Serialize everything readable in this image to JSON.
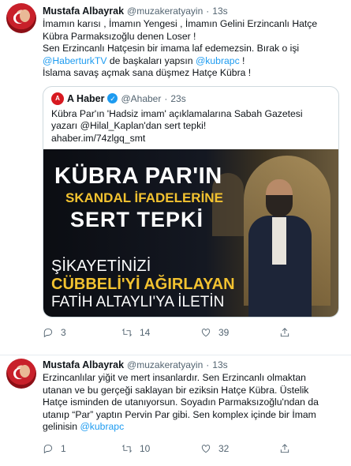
{
  "tweets": [
    {
      "name": "Mustafa Albayrak",
      "handle": "@muzakeratyayin",
      "dot": "·",
      "time": "13s",
      "lines": [
        {
          "parts": [
            {
              "t": "İmamın karısı , İmamın Yengesi , İmamın Gelini Erzincanlı Hatçe",
              "link": false
            }
          ]
        },
        {
          "parts": [
            {
              "t": "Kübra Parmaksızoğlu denen Loser !",
              "link": false
            }
          ]
        },
        {
          "parts": [
            {
              "t": "Sen Erzincanlı Hatçesin bir imama laf edemezsin. Bırak o işi",
              "link": false
            }
          ]
        },
        {
          "parts": [
            {
              "t": "@HaberturkTV",
              "link": true
            },
            {
              "t": " de başkaları yapsın ",
              "link": false
            },
            {
              "t": "@kubrapc",
              "link": true
            },
            {
              "t": " !",
              "link": false
            }
          ]
        },
        {
          "parts": [
            {
              "t": "İslama savaş açmak sana düşmez Hatçe Kübra !",
              "link": false
            }
          ]
        }
      ],
      "quote": {
        "logo_text": "A",
        "name": "A Haber",
        "verified_icon": "✓",
        "handle": "@Ahaber",
        "dot": "·",
        "time": "23s",
        "lines": [
          {
            "parts": [
              {
                "t": "Kübra Par'ın 'Hadsiz imam' açıklamalarına Sabah Gazetesi",
                "link": false
              }
            ]
          },
          {
            "parts": [
              {
                "t": "yazarı @Hilal_Kaplan'dan sert tepki!",
                "link": false
              }
            ]
          },
          {
            "parts": [
              {
                "t": "ahaber.im/74zlgq_smt",
                "link": false
              }
            ]
          }
        ],
        "image_text": {
          "line1": "KÜBRA PAR'IN",
          "line2": "SKANDAL İFADELERİNE",
          "line3": "SERT TEPKİ",
          "line4": "ŞİKAYETİNİZİ",
          "line5": "CÜBBELİ'Yİ AĞIRLAYAN",
          "line6": "FATİH ALTAYLI'YA İLETİN"
        }
      },
      "actions": {
        "reply": "3",
        "retweet": "14",
        "like": "39",
        "share": ""
      }
    },
    {
      "name": "Mustafa Albayrak",
      "handle": "@muzakeratyayin",
      "dot": "·",
      "time": "13s",
      "lines": [
        {
          "parts": [
            {
              "t": "Erzincanlılar yiğit ve mert insanlardır. Sen Erzincanlı olmaktan",
              "link": false
            }
          ]
        },
        {
          "parts": [
            {
              "t": "utanan ve bu gerçeği saklayan bir eziksin Hatçe Kübra. Üstelik",
              "link": false
            }
          ]
        },
        {
          "parts": [
            {
              "t": "Hatçe isminden de utanıyorsun. Soyadın Parmaksızoğlu'ndan da",
              "link": false
            }
          ]
        },
        {
          "parts": [
            {
              "t": "utanıp “Par” yaptın Pervin Par gibi. Sen  komplex içinde bir İmam",
              "link": false
            }
          ]
        },
        {
          "parts": [
            {
              "t": "gelinisin ",
              "link": false
            },
            {
              "t": "@kubrapc",
              "link": true
            }
          ]
        }
      ],
      "actions": {
        "reply": "1",
        "retweet": "10",
        "like": "32",
        "share": ""
      }
    }
  ],
  "colors": {
    "link": "#1d9bf0",
    "muted": "#536471",
    "border": "#cfd9de"
  }
}
